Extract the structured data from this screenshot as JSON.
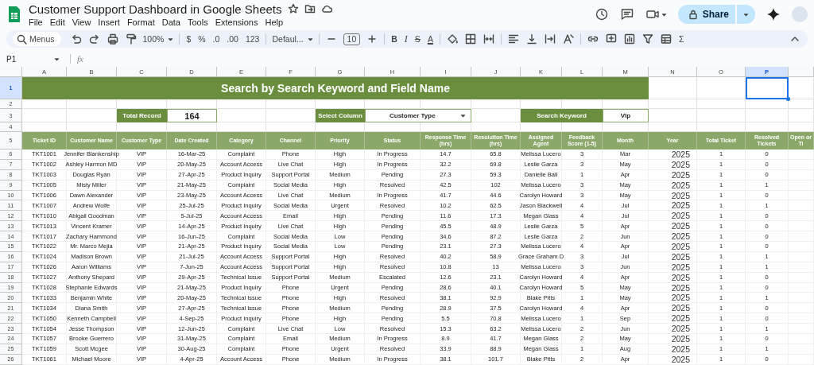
{
  "app": {
    "title": "Customer Support Dashboard in Google Sheets",
    "menus": [
      "File",
      "Edit",
      "View",
      "Insert",
      "Format",
      "Data",
      "Tools",
      "Extensions",
      "Help"
    ],
    "share": "Share"
  },
  "toolbar": [
    [
      {
        "kind": "search",
        "text": "Menus"
      },
      {
        "kind": "undo"
      },
      {
        "kind": "redo"
      },
      {
        "kind": "print"
      },
      {
        "kind": "paint-format"
      },
      {
        "kind": "dropdown",
        "text": "100%"
      }
    ],
    [
      {
        "kind": "text",
        "text": "$"
      },
      {
        "kind": "text",
        "text": "%"
      },
      {
        "kind": "text",
        "text": ".0"
      },
      {
        "kind": "text",
        "text": ".00"
      },
      {
        "kind": "text",
        "text": "123"
      }
    ],
    [
      {
        "kind": "dropdown",
        "text": "Defaul..."
      }
    ],
    [
      {
        "kind": "minus"
      },
      {
        "kind": "field",
        "text": "10"
      },
      {
        "kind": "plus"
      }
    ],
    [
      {
        "kind": "bold",
        "text": "B"
      },
      {
        "kind": "italic",
        "text": "I"
      },
      {
        "kind": "strike",
        "text": "S"
      },
      {
        "kind": "text-color",
        "text": "A"
      }
    ],
    [
      {
        "kind": "fill"
      },
      {
        "kind": "borders"
      },
      {
        "kind": "merge"
      }
    ],
    [
      {
        "kind": "align"
      },
      {
        "kind": "valign"
      },
      {
        "kind": "wrap"
      },
      {
        "kind": "rotate"
      }
    ],
    [
      {
        "kind": "link"
      },
      {
        "kind": "comment"
      },
      {
        "kind": "chart"
      },
      {
        "kind": "filter"
      },
      {
        "kind": "views"
      },
      {
        "kind": "text",
        "text": "Σ"
      }
    ]
  ],
  "formula_bar": {
    "cell_ref": "P1",
    "fx": "fx"
  },
  "column_letters": [
    {
      "label": "A",
      "selected": false
    },
    {
      "label": "B",
      "selected": false
    },
    {
      "label": "C",
      "selected": false
    },
    {
      "label": "D",
      "selected": false
    },
    {
      "label": "E",
      "selected": false
    },
    {
      "label": "F",
      "selected": false
    },
    {
      "label": "G",
      "selected": false
    },
    {
      "label": "H",
      "selected": false
    },
    {
      "label": "I",
      "selected": false
    },
    {
      "label": "J",
      "selected": false
    },
    {
      "label": "K",
      "selected": false
    },
    {
      "label": "L",
      "selected": false
    },
    {
      "label": "M",
      "selected": false
    },
    {
      "label": "N",
      "selected": false
    },
    {
      "label": "O",
      "selected": false
    },
    {
      "label": "P",
      "selected": true
    }
  ],
  "row_numbers": [
    {
      "label": "1",
      "selected": true
    },
    {
      "label": "2",
      "selected": false
    },
    {
      "label": "3",
      "selected": false
    },
    {
      "label": "4",
      "selected": false
    },
    {
      "label": "5",
      "selected": false
    },
    {
      "label": "6",
      "selected": false
    },
    {
      "label": "7",
      "selected": false
    },
    {
      "label": "8",
      "selected": false
    },
    {
      "label": "9",
      "selected": false
    },
    {
      "label": "10",
      "selected": false
    },
    {
      "label": "11",
      "selected": false
    },
    {
      "label": "12",
      "selected": false
    },
    {
      "label": "13",
      "selected": false
    },
    {
      "label": "14",
      "selected": false
    },
    {
      "label": "15",
      "selected": false
    },
    {
      "label": "16",
      "selected": false
    },
    {
      "label": "17",
      "selected": false
    },
    {
      "label": "18",
      "selected": false
    },
    {
      "label": "19",
      "selected": false
    },
    {
      "label": "20",
      "selected": false
    },
    {
      "label": "21",
      "selected": false
    },
    {
      "label": "22",
      "selected": false
    },
    {
      "label": "23",
      "selected": false
    },
    {
      "label": "24",
      "selected": false
    },
    {
      "label": "25",
      "selected": false
    },
    {
      "label": "26",
      "selected": false
    }
  ],
  "banner": "Search by Search Keyword and Field Name",
  "controls": {
    "total_record": {
      "label": "Total Record",
      "value": "164"
    },
    "select_column": {
      "label": "Select Column",
      "value": "Customer Type"
    },
    "search_keyword": {
      "label": "Search Keyword",
      "value": "Vlp"
    }
  },
  "table": {
    "columns": [
      "Ticket ID",
      "Customer Name",
      "Customer Type",
      "Date Created",
      "Category",
      "Channel",
      "Priority",
      "Status",
      "Response Time (hrs)",
      "Resolution Time (hrs)",
      "Assigned Agent",
      "Feedback Score (1-5)",
      "Month",
      "Year",
      "Total Ticket",
      "Resolved Tickets",
      "Open or Ti"
    ],
    "rows": [
      [
        "TKT1001",
        "Jennifer Blankenship",
        "VIP",
        "16-Mar-25",
        "Complaint",
        "Phone",
        "High",
        "In Progress",
        "14.7",
        "65.8",
        "Melissa Lucero",
        "3",
        "Mar",
        "2025",
        "1",
        "0"
      ],
      [
        "TKT1002",
        "Ashley Harmon MD",
        "VIP",
        "20-May-25",
        "Account Access",
        "Live Chat",
        "High",
        "In Progress",
        "32.2",
        "69.8",
        "Leslie Garza",
        "3",
        "May",
        "2025",
        "1",
        "0"
      ],
      [
        "TKT1003",
        "Douglas Ryan",
        "VIP",
        "27-Apr-25",
        "Product Inquiry",
        "Support Portal",
        "Medium",
        "Pending",
        "27.3",
        "59.3",
        "Danielle Ball",
        "1",
        "Apr",
        "2025",
        "1",
        "0"
      ],
      [
        "TKT1005",
        "Misty Miller",
        "VIP",
        "21-May-25",
        "Complaint",
        "Social Media",
        "High",
        "Resolved",
        "42.5",
        "102",
        "Melissa Lucero",
        "3",
        "May",
        "2025",
        "1",
        "1"
      ],
      [
        "TKT1006",
        "Dawn Alexander",
        "VIP",
        "23-May-25",
        "Account Access",
        "Live Chat",
        "Medium",
        "In Progress",
        "41.7",
        "44.6",
        "Carolyn Howard",
        "3",
        "May",
        "2025",
        "1",
        "0"
      ],
      [
        "TKT1007",
        "Andrew Wolfe",
        "VIP",
        "25-Jul-25",
        "Product Inquiry",
        "Social Media",
        "Urgent",
        "Resolved",
        "10.2",
        "62.5",
        "Jason Blackwell",
        "4",
        "Jul",
        "2025",
        "1",
        "1"
      ],
      [
        "TKT1010",
        "Abigail Goodman",
        "VIP",
        "5-Jul-25",
        "Account Access",
        "Email",
        "High",
        "Pending",
        "11.6",
        "17.3",
        "Megan Glass",
        "4",
        "Jul",
        "2025",
        "1",
        "0"
      ],
      [
        "TKT1013",
        "Vincent Kramer",
        "VIP",
        "14-Apr-25",
        "Product Inquiry",
        "Live Chat",
        "High",
        "Pending",
        "45.5",
        "48.9",
        "Leslie Garza",
        "5",
        "Apr",
        "2025",
        "1",
        "0"
      ],
      [
        "TKT1017",
        "Zachary Hammond",
        "VIP",
        "16-Jun-25",
        "Complaint",
        "Social Media",
        "Low",
        "Pending",
        "34.6",
        "87.2",
        "Leslie Garza",
        "2",
        "Jun",
        "2025",
        "1",
        "0"
      ],
      [
        "TKT1022",
        "Mr. Marco Mejia",
        "VIP",
        "21-Apr-25",
        "Product Inquiry",
        "Social Media",
        "Low",
        "Pending",
        "23.1",
        "27.3",
        "Melissa Lucero",
        "4",
        "Apr",
        "2025",
        "1",
        "0"
      ],
      [
        "TKT1024",
        "Madison Brown",
        "VIP",
        "21-Jul-25",
        "Account Access",
        "Support Portal",
        "High",
        "Resolved",
        "40.2",
        "58.9",
        "Grace Graham D",
        "3",
        "Jul",
        "2025",
        "1",
        "1"
      ],
      [
        "TKT1026",
        "Aaron Williams",
        "VIP",
        "7-Jun-25",
        "Account Access",
        "Support Portal",
        "High",
        "Resolved",
        "10.8",
        "13",
        "Melissa Lucero",
        "3",
        "Jun",
        "2025",
        "1",
        "1"
      ],
      [
        "TKT1027",
        "Anthony Shepard",
        "VIP",
        "29-Apr-25",
        "Technical Issue",
        "Support Portal",
        "Medium",
        "Escalated",
        "12.6",
        "23.1",
        "Carolyn Howard",
        "4",
        "Apr",
        "2025",
        "1",
        "0"
      ],
      [
        "TKT1028",
        "Stephanie Edwards",
        "VIP",
        "21-May-25",
        "Product Inquiry",
        "Phone",
        "Urgent",
        "Pending",
        "28.6",
        "40.1",
        "Carolyn Howard",
        "5",
        "May",
        "2025",
        "1",
        "0"
      ],
      [
        "TKT1033",
        "Benjamin White",
        "VIP",
        "20-May-25",
        "Technical Issue",
        "Phone",
        "High",
        "Resolved",
        "38.1",
        "92.9",
        "Blake Pitts",
        "1",
        "May",
        "2025",
        "1",
        "1"
      ],
      [
        "TKT1034",
        "Diana Smith",
        "VIP",
        "27-Apr-25",
        "Technical Issue",
        "Phone",
        "Medium",
        "Pending",
        "28.9",
        "37.5",
        "Carolyn Howard",
        "4",
        "Apr",
        "2025",
        "1",
        "0"
      ],
      [
        "TKT1050",
        "Kenneth Campbell",
        "VIP",
        "4-Sep-25",
        "Product Inquiry",
        "Phone",
        "High",
        "Pending",
        "5.5",
        "70.8",
        "Melissa Lucero",
        "1",
        "Sep",
        "2025",
        "1",
        "0"
      ],
      [
        "TKT1054",
        "Jesse Thompson",
        "VIP",
        "12-Jun-25",
        "Complaint",
        "Live Chat",
        "Low",
        "Resolved",
        "15.3",
        "63.2",
        "Melissa Lucero",
        "2",
        "Jun",
        "2025",
        "1",
        "1"
      ],
      [
        "TKT1057",
        "Brooke Guerrero",
        "VIP",
        "31-May-25",
        "Complaint",
        "Email",
        "Medium",
        "In Progress",
        "8.9",
        "41.7",
        "Megan Glass",
        "2",
        "May",
        "2025",
        "1",
        "0"
      ],
      [
        "TKT1059",
        "Scott Mcgee",
        "VIP",
        "30-Aug-25",
        "Complaint",
        "Phone",
        "Urgent",
        "Resolved",
        "33.9",
        "88.9",
        "Megan Glass",
        "1",
        "Aug",
        "2025",
        "1",
        "1"
      ],
      [
        "TKT1061",
        "Michael Moore",
        "VIP",
        "4-Apr-25",
        "Account Access",
        "Phone",
        "Medium",
        "In Progress",
        "38.1",
        "101.7",
        "Blake Pitts",
        "2",
        "Apr",
        "2025",
        "1",
        "0"
      ]
    ]
  }
}
